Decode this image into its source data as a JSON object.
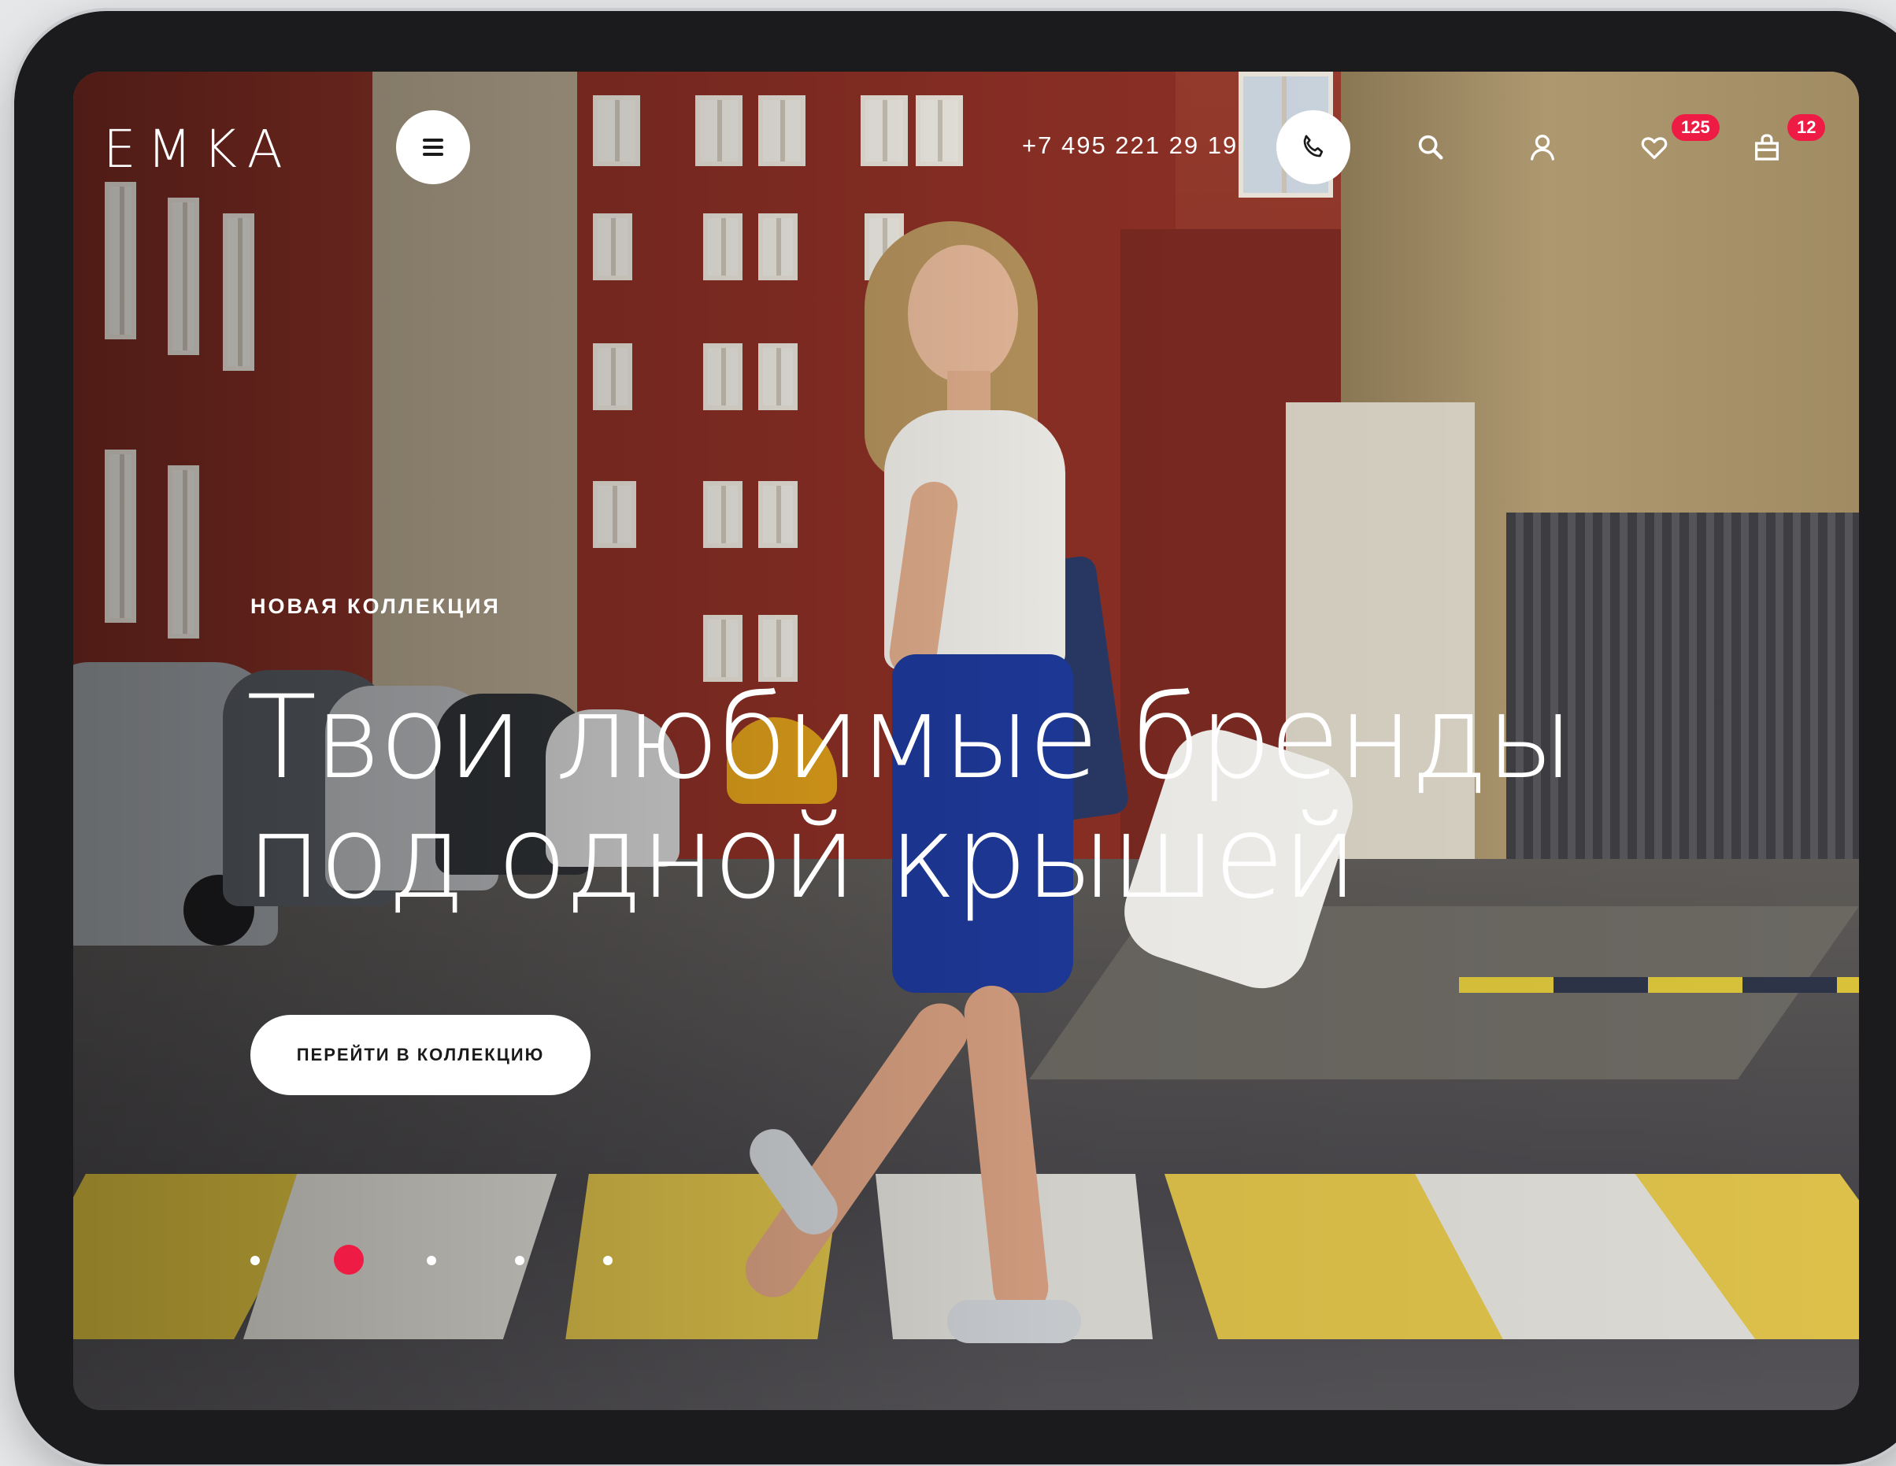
{
  "brand": {
    "logo": "EMKA"
  },
  "header": {
    "phone": "+7 495 221 29 19",
    "favorites_count": "125",
    "cart_count": "12"
  },
  "hero": {
    "eyebrow": "НОВАЯ КОЛЛЕКЦИЯ",
    "headline_line1": "Твои любимые бренды",
    "headline_line2": "под одной крышей",
    "cta_label": "ПЕРЕЙТИ В КОЛЛЕКЦИЮ"
  },
  "slider": {
    "slide_count": 5,
    "active_index": 1
  },
  "colors": {
    "accent": "#ee1c44",
    "device": "#1b1b1d",
    "button_bg": "#ffffff"
  },
  "icons": {
    "menu": "menu-icon",
    "phone": "phone-icon",
    "search": "search-icon",
    "account": "user-icon",
    "favorites": "heart-icon",
    "cart": "shopping-bag-icon"
  }
}
